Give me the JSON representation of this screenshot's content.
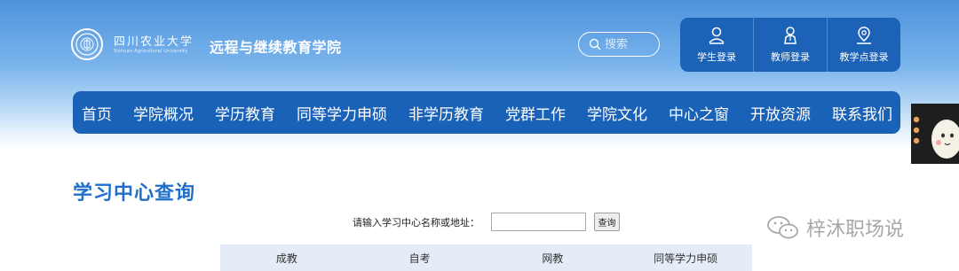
{
  "header": {
    "logo_cn": "四川农业大学",
    "logo_en": "Sichuan Agricultural University",
    "site_title": "远程与继续教育学院",
    "search_placeholder": "搜索"
  },
  "login": {
    "items": [
      {
        "label": "学生登录",
        "icon": "student-user-icon"
      },
      {
        "label": "教师登录",
        "icon": "teacher-user-icon"
      },
      {
        "label": "教学点登录",
        "icon": "location-pin-icon"
      }
    ]
  },
  "nav": {
    "items": [
      {
        "label": "首页"
      },
      {
        "label": "学院概况"
      },
      {
        "label": "学历教育"
      },
      {
        "label": "同等学力申硕"
      },
      {
        "label": "非学历教育"
      },
      {
        "label": "党群工作"
      },
      {
        "label": "学院文化"
      },
      {
        "label": "中心之窗"
      },
      {
        "label": "开放资源"
      },
      {
        "label": "联系我们"
      }
    ]
  },
  "main": {
    "heading": "学习中心查询",
    "query_label": "请输入学习中心名称或地址：",
    "query_value": "",
    "query_button": "查询",
    "tabs": [
      {
        "label": "成教"
      },
      {
        "label": "自考"
      },
      {
        "label": "网教"
      },
      {
        "label": "同等学力申硕"
      }
    ]
  },
  "watermark": {
    "text": "梓沐职场说",
    "icon": "wechat-icon"
  },
  "colors": {
    "primary": "#1a62b7",
    "heading": "#1f6fcb",
    "tab_bg": "#e4ecf7"
  }
}
